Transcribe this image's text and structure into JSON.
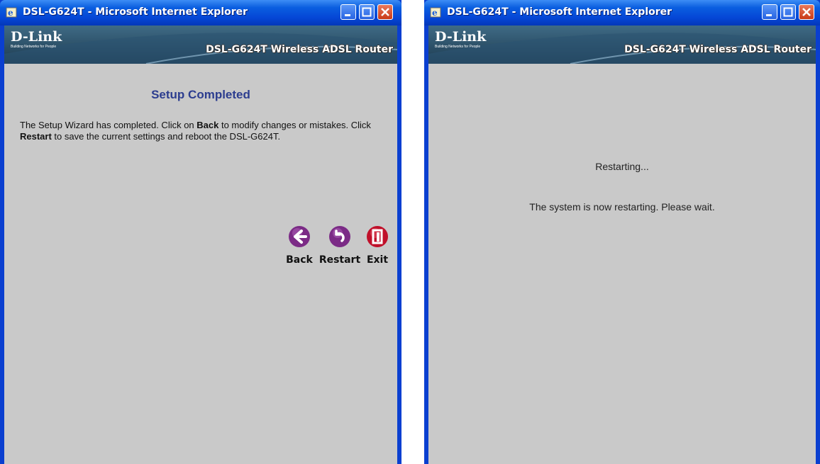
{
  "window1": {
    "title": "DSL-G624T - Microsoft Internet Explorer",
    "banner": {
      "logo": "D-Link",
      "tagline": "Building Networks for People",
      "router_title": "DSL-G624T Wireless ADSL Router"
    },
    "heading": "Setup Completed",
    "description": {
      "part1": "The Setup Wizard has completed. Click on ",
      "back_word": "Back",
      "part2": " to modify changes or mistakes. Click ",
      "restart_word": "Restart",
      "part3": " to save the current settings and reboot the DSL-G624T."
    },
    "buttons": {
      "back": "Back",
      "restart": "Restart",
      "exit": "Exit"
    }
  },
  "window2": {
    "title": "DSL-G624T - Microsoft Internet Explorer",
    "banner": {
      "logo": "D-Link",
      "tagline": "Building Networks for People",
      "router_title": "DSL-G624T Wireless ADSL Router"
    },
    "status": "Restarting...",
    "message": "The system is now restarting. Please wait."
  },
  "colors": {
    "titlebar": "#0546d6",
    "content_bg": "#c9c9c9",
    "heading": "#2c3d8f",
    "button_purple": "#7b2b86",
    "exit_red": "#c0102a"
  }
}
